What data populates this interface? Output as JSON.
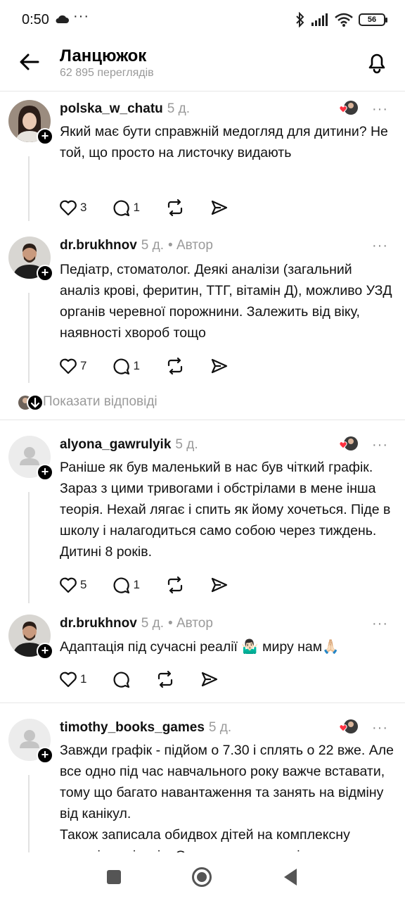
{
  "status_bar": {
    "time": "0:50",
    "dots": "···",
    "battery": "56"
  },
  "header": {
    "title": "Ланцюжок",
    "views": "62 895 переглядів"
  },
  "posts": [
    {
      "username": "polska_w_chatu",
      "time": "5 д.",
      "author_tag": "",
      "text": "Який має бути справжній медогляд для дитини? Не той, що просто на листочку видають",
      "likes": "3",
      "replies": "1"
    },
    {
      "username": "dr.brukhnov",
      "time": "5 д.",
      "author_tag": "• Автор",
      "text": "Педіатр, стоматолог. Деякі аналізи (загальний аналіз крові, феритин, ТТГ, вітамін Д), можливо УЗД органів черевної порожнини. Залежить від віку, наявності хвороб тощо",
      "likes": "7",
      "replies": "1"
    },
    {
      "username": "alyona_gawrulyik",
      "time": "5 д.",
      "author_tag": "",
      "text": "Раніше як був маленький в нас був чіткий графік. Зараз з цими тривогами і обстрілами в мене інша теорія. Нехай лягає і спить як йому хочеться. Піде в школу і налагодиться само собою через тиждень. Дитині 8 років.",
      "likes": "5",
      "replies": "1"
    },
    {
      "username": "dr.brukhnov",
      "time": "5 д.",
      "author_tag": "• Автор",
      "text": "Адаптація під сучасні реалії 🤷🏻‍♂️ миру нам🙏🏻",
      "likes": "1",
      "replies": ""
    },
    {
      "username": "timothy_books_games",
      "time": "5 д.",
      "author_tag": "",
      "text": "Завжди графік - підйом о 7.30 і сплять о 22 вже. Але все одно під час навчального року важче вставати, тому що багато навантаження та занять на відміну від канікул.\nТакож записала обидвох дітей на комплексну перевірку лікарів. Одина питання - скільки"
    }
  ],
  "show_replies_label": "Показати відповіді",
  "more_glyph": "···",
  "icons": {
    "back": "arrow-left-icon",
    "bell": "bell-icon",
    "like": "heart-icon",
    "reply": "comment-icon",
    "repost": "repost-icon",
    "share": "send-icon"
  },
  "colors": {
    "text": "#111111",
    "muted": "#9a9a9a",
    "divider": "#e6e6e6",
    "like_red": "#ff3040"
  }
}
